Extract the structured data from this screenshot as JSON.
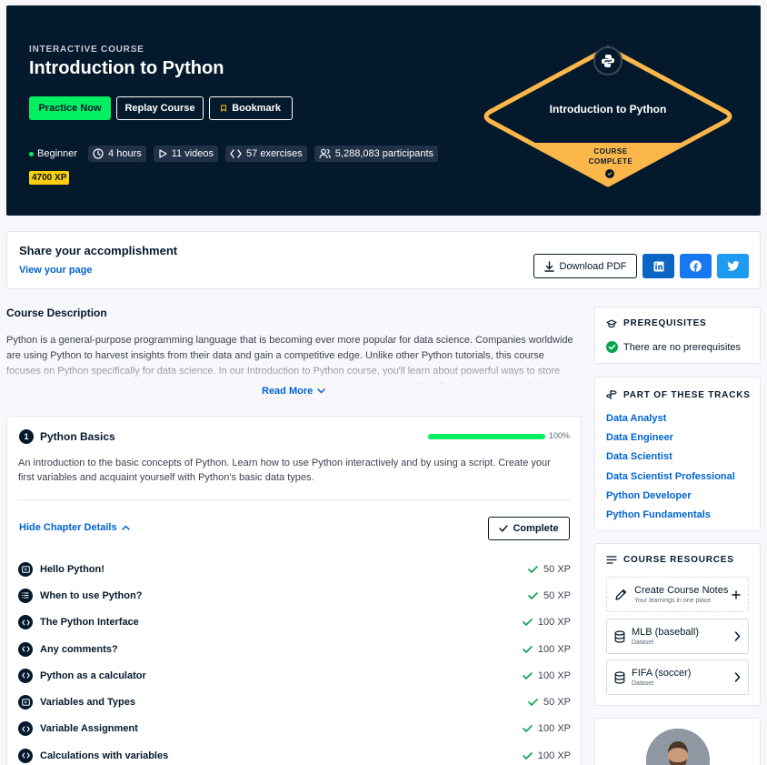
{
  "hero": {
    "eyebrow": "INTERACTIVE COURSE",
    "title": "Introduction to Python",
    "buttons": {
      "practice": "Practice Now",
      "replay": "Replay Course",
      "bookmark": "Bookmark"
    },
    "meta": {
      "level": "Beginner",
      "hours": "4 hours",
      "videos": "11 videos",
      "exercises": "57 exercises",
      "participants": "5,288,083 participants"
    },
    "xp": "4700 XP",
    "badge": {
      "title": "Introduction to Python",
      "status_line1": "COURSE",
      "status_line2": "COMPLETE"
    }
  },
  "share": {
    "title": "Share your accomplishment",
    "link": "View your page",
    "download": "Download PDF",
    "icons": [
      "linkedin-icon",
      "facebook-icon",
      "twitter-icon"
    ],
    "colors": {
      "linkedin": "#0a66c2",
      "facebook": "#1877f2",
      "twitter": "#1d9bf0"
    }
  },
  "description": {
    "heading": "Course Description",
    "text": "Python is a general-purpose programming language that is becoming ever more popular for data science. Companies worldwide are using Python to harvest insights from their data and gain a competitive edge. Unlike other Python tutorials, this course focuses on Python specifically for data science. In our Introduction to Python course, you'll learn about powerful ways to store and manipulate data, and helpful data science tools to begin conducting your own analyses. Start DataCamp's online Python",
    "read_more": "Read More"
  },
  "chapter": {
    "number": "1",
    "title": "Python Basics",
    "progress": 1.0,
    "progress_label": "100%",
    "description": "An introduction to the basic concepts of Python. Learn how to use Python interactively and by using a script. Create your first variables and acquaint yourself with Python's basic data types.",
    "hide_details": "Hide Chapter Details",
    "complete": "Complete",
    "exercises": [
      {
        "label": "Hello Python!",
        "xp": "50 XP",
        "icon": "video-icon"
      },
      {
        "label": "When to use Python?",
        "xp": "50 XP",
        "icon": "list-icon"
      },
      {
        "label": "The Python Interface",
        "xp": "100 XP",
        "icon": "code-icon"
      },
      {
        "label": "Any comments?",
        "xp": "100 XP",
        "icon": "code-icon"
      },
      {
        "label": "Python as a calculator",
        "xp": "100 XP",
        "icon": "code-icon"
      },
      {
        "label": "Variables and Types",
        "xp": "50 XP",
        "icon": "video-icon"
      },
      {
        "label": "Variable Assignment",
        "xp": "100 XP",
        "icon": "code-icon"
      },
      {
        "label": "Calculations with variables",
        "xp": "100 XP",
        "icon": "code-icon"
      }
    ]
  },
  "prerequisites": {
    "heading": "PREREQUISITES",
    "text": "There are no prerequisites"
  },
  "tracks": {
    "heading": "PART OF THESE TRACKS",
    "items": [
      "Data Analyst",
      "Data Engineer",
      "Data Scientist",
      "Data Scientist Professional",
      "Python Developer",
      "Python Fundamentals"
    ]
  },
  "resources": {
    "heading": "COURSE RESOURCES",
    "notes": {
      "title": "Create Course Notes",
      "sub": "Your learnings in one place"
    },
    "items": [
      {
        "title": "MLB (baseball)",
        "sub": "Dataset"
      },
      {
        "title": "FIFA (soccer)",
        "sub": "Dataset"
      }
    ]
  },
  "colors": {
    "navy": "#05192d",
    "green": "#03ef62",
    "yellow": "#fcce0d",
    "badge_gold": "#fcb74a",
    "link_blue": "#0065d1"
  }
}
